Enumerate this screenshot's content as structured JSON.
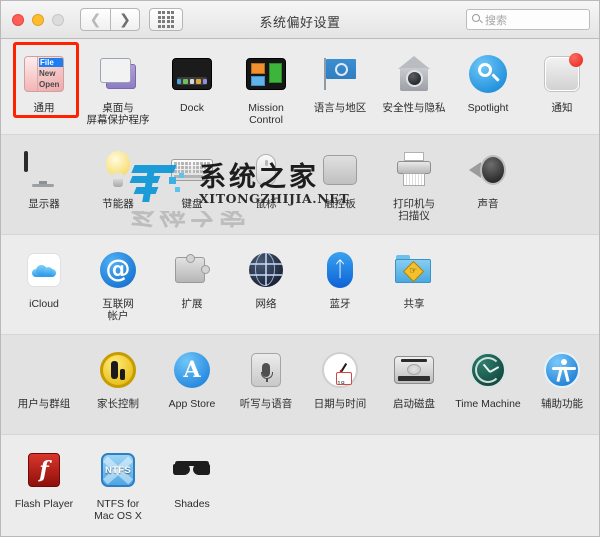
{
  "window": {
    "title": "系统偏好设置",
    "traffic_lights": [
      "close",
      "minimize",
      "zoom"
    ],
    "nav": {
      "back_icon": "chevron-left-icon",
      "forward_icon": "chevron-right-icon",
      "grid_icon": "show-all-grid-icon"
    },
    "search": {
      "placeholder": "搜索",
      "value": "",
      "icon": "search-icon"
    }
  },
  "rows": [
    {
      "id": "personal",
      "items": [
        {
          "label": "通用",
          "icon": "general-menu-icon",
          "selected": true
        },
        {
          "label": "桌面与\n屏幕保护程序",
          "icon": "desktop-screensaver-icon",
          "selected": false
        },
        {
          "label": "Dock",
          "icon": "dock-icon",
          "selected": false
        },
        {
          "label": "Mission\nControl",
          "icon": "mission-control-icon",
          "selected": false
        },
        {
          "label": "语言与地区",
          "icon": "language-region-flag-icon",
          "selected": false
        },
        {
          "label": "安全性与隐私",
          "icon": "security-privacy-house-icon",
          "selected": false
        },
        {
          "label": "Spotlight",
          "icon": "spotlight-magnifier-icon",
          "selected": false
        },
        {
          "label": "通知",
          "icon": "notifications-icon",
          "selected": false
        }
      ]
    },
    {
      "id": "hardware",
      "items": [
        {
          "label": "显示器",
          "icon": "displays-monitor-icon",
          "selected": false
        },
        {
          "label": "节能器",
          "icon": "energy-saver-bulb-icon",
          "selected": false
        },
        {
          "label": "键盘",
          "icon": "keyboard-icon",
          "selected": false
        },
        {
          "label": "鼠标",
          "icon": "mouse-icon",
          "selected": false
        },
        {
          "label": "触控板",
          "icon": "trackpad-icon",
          "selected": false
        },
        {
          "label": "打印机与\n扫描仪",
          "icon": "printers-scanners-icon",
          "selected": false
        },
        {
          "label": "声音",
          "icon": "sound-speaker-icon",
          "selected": false
        }
      ]
    },
    {
      "id": "internet",
      "items": [
        {
          "label": "iCloud",
          "icon": "icloud-icon",
          "selected": false
        },
        {
          "label": "互联网\n帐户",
          "icon": "internet-accounts-at-icon",
          "selected": false
        },
        {
          "label": "扩展",
          "icon": "extensions-puzzle-icon",
          "selected": false
        },
        {
          "label": "网络",
          "icon": "network-globe-icon",
          "selected": false
        },
        {
          "label": "蓝牙",
          "icon": "bluetooth-icon",
          "selected": false
        },
        {
          "label": "共享",
          "icon": "sharing-folder-icon",
          "selected": false
        }
      ]
    },
    {
      "id": "system",
      "items": [
        {
          "label": "用户与群组",
          "icon": "users-groups-icon",
          "selected": false
        },
        {
          "label": "家长控制",
          "icon": "parental-controls-icon",
          "selected": false
        },
        {
          "label": "App Store",
          "icon": "app-store-icon",
          "selected": false
        },
        {
          "label": "听写与语音",
          "icon": "dictation-speech-mic-icon",
          "selected": false
        },
        {
          "label": "日期与时间",
          "icon": "date-time-clock-icon",
          "selected": false
        },
        {
          "label": "启动磁盘",
          "icon": "startup-disk-icon",
          "selected": false
        },
        {
          "label": "Time Machine",
          "icon": "time-machine-icon",
          "selected": false
        },
        {
          "label": "辅助功能",
          "icon": "accessibility-icon",
          "selected": false
        }
      ]
    },
    {
      "id": "other",
      "items": [
        {
          "label": "Flash Player",
          "icon": "flash-player-icon",
          "selected": false
        },
        {
          "label": "NTFS for\nMac OS X",
          "icon": "ntfs-mac-icon",
          "selected": false
        },
        {
          "label": "Shades",
          "icon": "shades-sunglasses-icon",
          "selected": false
        }
      ]
    }
  ],
  "watermark": {
    "cn": "系统之家",
    "en": "XITONGZHIJIA.NET",
    "logo": "xitongzhijia-logo-icon"
  },
  "colors": {
    "selection_outline": "#ff2200",
    "accent_blue": "#1e7df0",
    "badge_red": "#e0231b",
    "window_bg": "#ececec",
    "row_alt_bg": "#e2e2e2"
  },
  "calendar_day": "18"
}
